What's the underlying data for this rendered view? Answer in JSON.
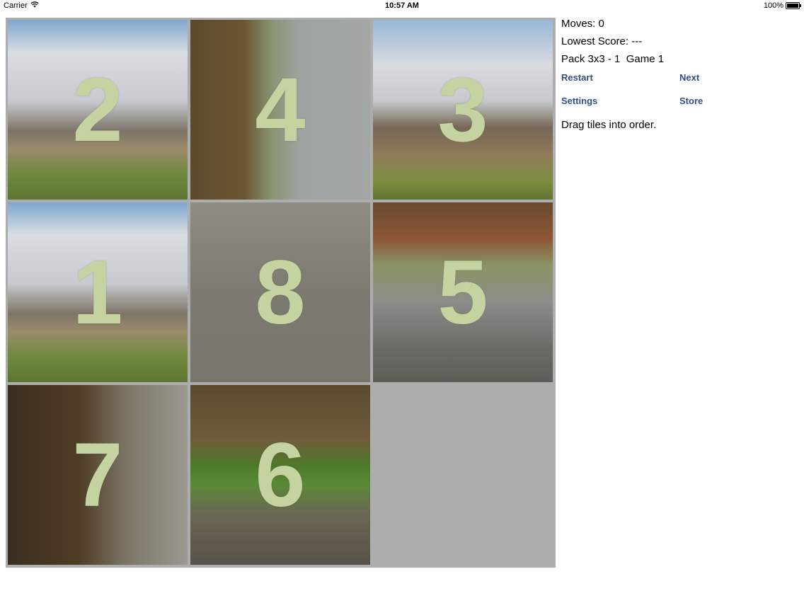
{
  "status_bar": {
    "carrier": "Carrier",
    "time": "10:57 AM",
    "battery": "100%"
  },
  "board": {
    "tiles": [
      {
        "number": "2",
        "slot": 0
      },
      {
        "number": "4",
        "slot": 1
      },
      {
        "number": "3",
        "slot": 2
      },
      {
        "number": "1",
        "slot": 3
      },
      {
        "number": "8",
        "slot": 4
      },
      {
        "number": "5",
        "slot": 5
      },
      {
        "number": "7",
        "slot": 6
      },
      {
        "number": "6",
        "slot": 7
      }
    ],
    "empty_slot": 8,
    "grid": "3x3",
    "number_color": "#c5d3a1"
  },
  "panel": {
    "moves": "Moves: 0",
    "lowest_score": "Lowest Score: ---",
    "pack_game": "Pack 3x3 - 1  Game 1",
    "restart": "Restart",
    "next": "Next",
    "settings": "Settings",
    "store": "Store",
    "hint": "Drag tiles into order."
  },
  "colors": {
    "button_text": "#2d4f86",
    "board_background": "#adadae"
  }
}
